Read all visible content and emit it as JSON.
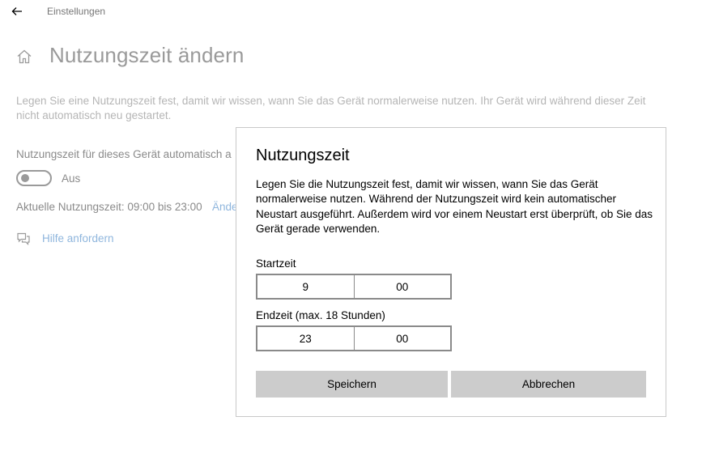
{
  "app": {
    "title": "Einstellungen"
  },
  "page": {
    "title": "Nutzungszeit ändern",
    "intro": "Legen Sie eine Nutzungszeit fest, damit wir wissen, wann Sie das Gerät normalerweise nutzen. Ihr Gerät wird während dieser Zeit nicht automatisch neu gestartet.",
    "auto_label": "Nutzungszeit für dieses Gerät automatisch a",
    "toggle_state": "Aus",
    "current_time": "Aktuelle Nutzungszeit: 09:00 bis 23:00",
    "change_link": "Ände",
    "help_link": "Hilfe anfordern"
  },
  "dialog": {
    "title": "Nutzungszeit",
    "description": "Legen Sie die Nutzungszeit fest, damit wir wissen, wann Sie das Gerät normalerweise nutzen. Während der Nutzungszeit wird kein automatischer Neustart ausgeführt. Außerdem wird vor einem Neustart erst überprüft, ob Sie das Gerät gerade verwenden.",
    "start": {
      "label": "Startzeit",
      "hour": "9",
      "minute": "00"
    },
    "end": {
      "label": "Endzeit (max. 18 Stunden)",
      "hour": "23",
      "minute": "00"
    },
    "save_label": "Speichern",
    "cancel_label": "Abbrechen"
  },
  "icons": {
    "back": "back-arrow-icon",
    "home": "home-icon",
    "help": "help-chat-icon"
  }
}
